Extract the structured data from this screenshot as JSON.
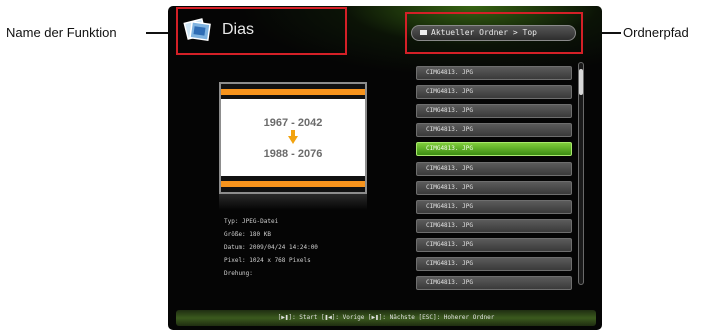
{
  "callouts": {
    "function_name": "Name der Funktion",
    "folder_path": "Ordnerpfad"
  },
  "header": {
    "title": "Dias",
    "title_icon": "photo-stack-icon",
    "folder_path": "Aktueller Ordner > Top",
    "folder_icon": "folder-icon"
  },
  "preview": {
    "range1": "1967 - 2042",
    "range2": "1988 - 2076",
    "arrow_icon": "arrow-down-icon",
    "bar_color": "#f7941d"
  },
  "info": {
    "type": "Typ: JPEG-Datei",
    "size": "Größe: 180 KB",
    "date": "Datum: 2009/04/24 14:24:00",
    "pixels": "Pixel: 1024 x 768 Pixels",
    "rotation": "Drehung:"
  },
  "files": [
    "CIMG4813. JPG",
    "CIMG4813. JPG",
    "CIMG4813. JPG",
    "CIMG4813. JPG",
    "CIMG4813. JPG",
    "CIMG4813. JPG",
    "CIMG4813. JPG",
    "CIMG4813. JPG",
    "CIMG4813. JPG",
    "CIMG4813. JPG",
    "CIMG4813. JPG",
    "CIMG4813. JPG"
  ],
  "selected_index": 4,
  "footer": {
    "text": "[▶❚]: Start [❚◀]: Vorige [▶❚]: Nächste [ESC]: Hoherer Ordner"
  },
  "colors": {
    "highlight": "#d42027",
    "selected": "#5fae26"
  }
}
